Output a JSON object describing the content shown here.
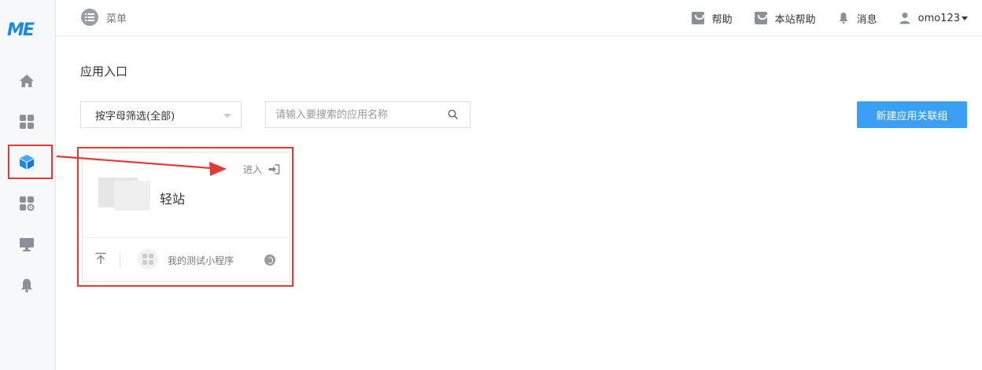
{
  "logo": {
    "text": "ME"
  },
  "sidebar": {
    "items": [
      {
        "name": "home",
        "icon": "home-icon"
      },
      {
        "name": "apps",
        "icon": "grid-icon"
      },
      {
        "name": "packages",
        "icon": "cube-icon",
        "active": true
      },
      {
        "name": "app-settings",
        "icon": "grid-gear-icon"
      },
      {
        "name": "monitor",
        "icon": "monitor-icon"
      },
      {
        "name": "notifications",
        "icon": "bell-icon"
      }
    ]
  },
  "topbar": {
    "menu_label": "菜单",
    "links": [
      {
        "label": "帮助",
        "icon": "shopping-bag-icon"
      },
      {
        "label": "本站帮助",
        "icon": "shopping-bag-icon"
      },
      {
        "label": "消息",
        "icon": "bell-icon"
      }
    ],
    "user": "omo123"
  },
  "main": {
    "title": "应用入口",
    "filter_value": "按字母筛选(全部)",
    "search_placeholder": "请输入要搜索的应用名称",
    "create_button": "新建应用关联组"
  },
  "card": {
    "enter_label": "进入",
    "app_name": "轻站",
    "mini_program_label": "我的测试小程序"
  },
  "colors": {
    "brand": "#1e88e5",
    "primary_button": "#3a9ff5",
    "annotation": "#e53935"
  }
}
